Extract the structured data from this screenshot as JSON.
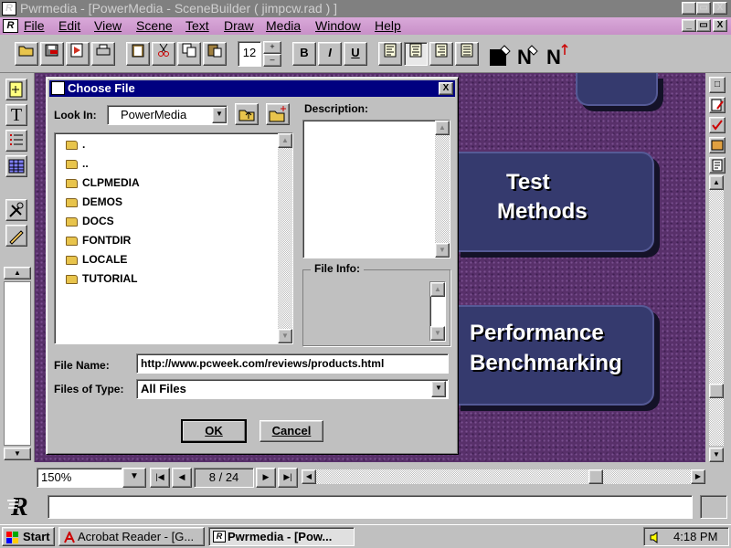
{
  "app": {
    "title": "Pwrmedia - [PowerMedia - SceneBuilder ( jimpcw.rad ) ]",
    "icon_glyph": "R",
    "caption_buttons": [
      "_",
      "▭",
      "X"
    ],
    "menu": [
      "File",
      "Edit",
      "View",
      "Scene",
      "Text",
      "Draw",
      "Media",
      "Window",
      "Help"
    ],
    "mdi_buttons": [
      "_",
      "▭",
      "X"
    ]
  },
  "toolbar": {
    "font_size": "12",
    "style_buttons": [
      "B",
      "I",
      "U"
    ],
    "icons": [
      "open-icon",
      "save-icon",
      "import-icon",
      "print-icon",
      "clipboard-icon",
      "cut-icon",
      "copy-icon",
      "paste-icon",
      "bold",
      "italic",
      "underline",
      "align-left-icon",
      "align-center-icon",
      "align-right-icon",
      "align-justify-icon",
      "fill-color-icon",
      "text-color-icon",
      "text-style-icon"
    ]
  },
  "slide": {
    "box1": [
      "Test",
      "Methods"
    ],
    "box2": [
      "Performance",
      "Benchmarking"
    ]
  },
  "dialog": {
    "title": "Choose File",
    "look_in_label": "Look In:",
    "look_in_value": "PowerMedia",
    "description_label": "Description:",
    "file_info_label": "File Info:",
    "files": [
      ".",
      "..",
      "CLPMEDIA",
      "DEMOS",
      "DOCS",
      "FONTDIR",
      "LOCALE",
      "TUTORIAL"
    ],
    "file_name_label": "File Name:",
    "file_name_value": "http://www.pcweek.com/reviews/products.html",
    "files_of_type_label": "Files of Type:",
    "files_of_type_value": "All Files",
    "ok_label": "OK",
    "cancel_label": "Cancel",
    "close_glyph": "X"
  },
  "nav": {
    "zoom": "150%",
    "page_current": "8",
    "page_separator": "/",
    "page_total": "24"
  },
  "taskbar": {
    "start_label": "Start",
    "tasks": [
      "Acrobat Reader - [G...",
      "Pwrmedia - [Pow..."
    ],
    "clock": "4:18 PM"
  }
}
